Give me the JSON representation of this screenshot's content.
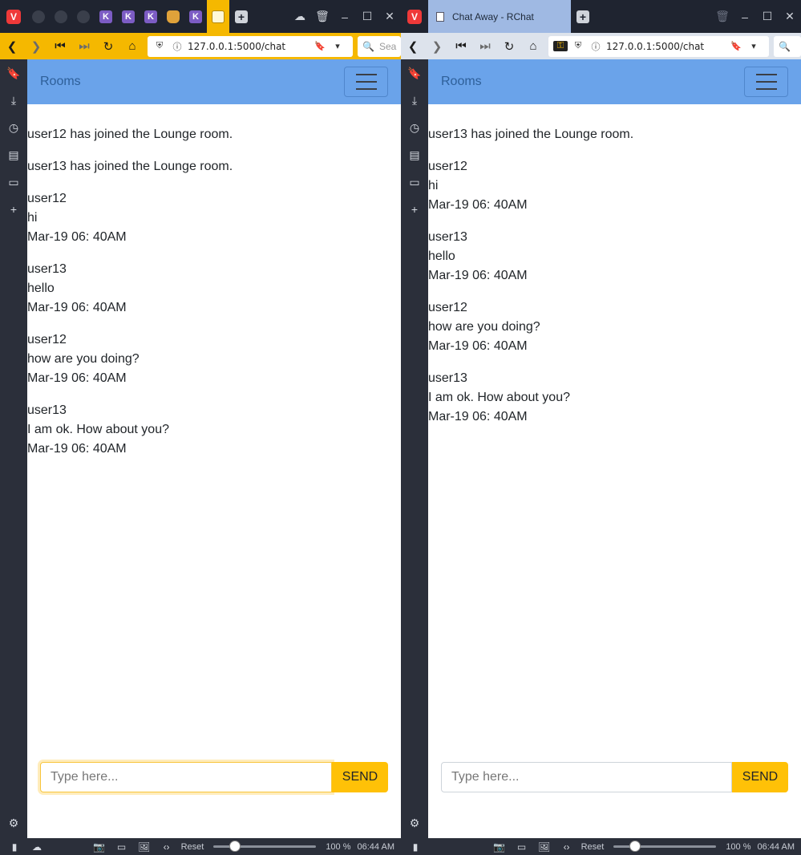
{
  "left": {
    "url": "127.0.0.1:5000/chat",
    "search_placeholder": "Sea",
    "nav": {
      "brand": "Rooms"
    },
    "messages": [
      {
        "type": "system",
        "text": "user12 has joined the Lounge room."
      },
      {
        "type": "system",
        "text": "user13 has joined the Lounge room."
      },
      {
        "type": "chat",
        "user": "user12",
        "text": "hi",
        "time": "Mar-19 06: 40AM"
      },
      {
        "type": "chat",
        "user": "user13",
        "text": "hello",
        "time": "Mar-19 06: 40AM"
      },
      {
        "type": "chat",
        "user": "user12",
        "text": "how are you doing?",
        "time": "Mar-19 06: 40AM"
      },
      {
        "type": "chat",
        "user": "user13",
        "text": "I am ok. How about you?",
        "time": "Mar-19 06: 40AM"
      }
    ],
    "input_placeholder": "Type here...",
    "send_label": "SEND",
    "status": {
      "reset": "Reset",
      "zoom": "100 %",
      "clock": "06:44 AM"
    }
  },
  "right": {
    "tab_title": "Chat Away - RChat",
    "url": "127.0.0.1:5000/chat",
    "nav": {
      "brand": "Rooms"
    },
    "messages": [
      {
        "type": "system",
        "text": "user13 has joined the Lounge room."
      },
      {
        "type": "chat",
        "user": "user12",
        "text": "hi",
        "time": "Mar-19 06: 40AM"
      },
      {
        "type": "chat",
        "user": "user13",
        "text": "hello",
        "time": "Mar-19 06: 40AM"
      },
      {
        "type": "chat",
        "user": "user12",
        "text": "how are you doing?",
        "time": "Mar-19 06: 40AM"
      },
      {
        "type": "chat",
        "user": "user13",
        "text": "I am ok. How about you?",
        "time": "Mar-19 06: 40AM"
      }
    ],
    "input_placeholder": "Type here...",
    "send_label": "SEND",
    "status": {
      "reset": "Reset",
      "zoom": "100 %",
      "clock": "06:44 AM"
    }
  },
  "colors": {
    "navbar": "#6aa3ea",
    "send": "#ffc107",
    "left_chrome": "#f5b800",
    "right_chrome": "#dde3ec"
  },
  "tab_icons": [
    "github-icon",
    "github-icon",
    "github-icon",
    "k-icon",
    "k-icon",
    "k-icon",
    "jar-icon",
    "k-icon",
    "page-icon"
  ]
}
